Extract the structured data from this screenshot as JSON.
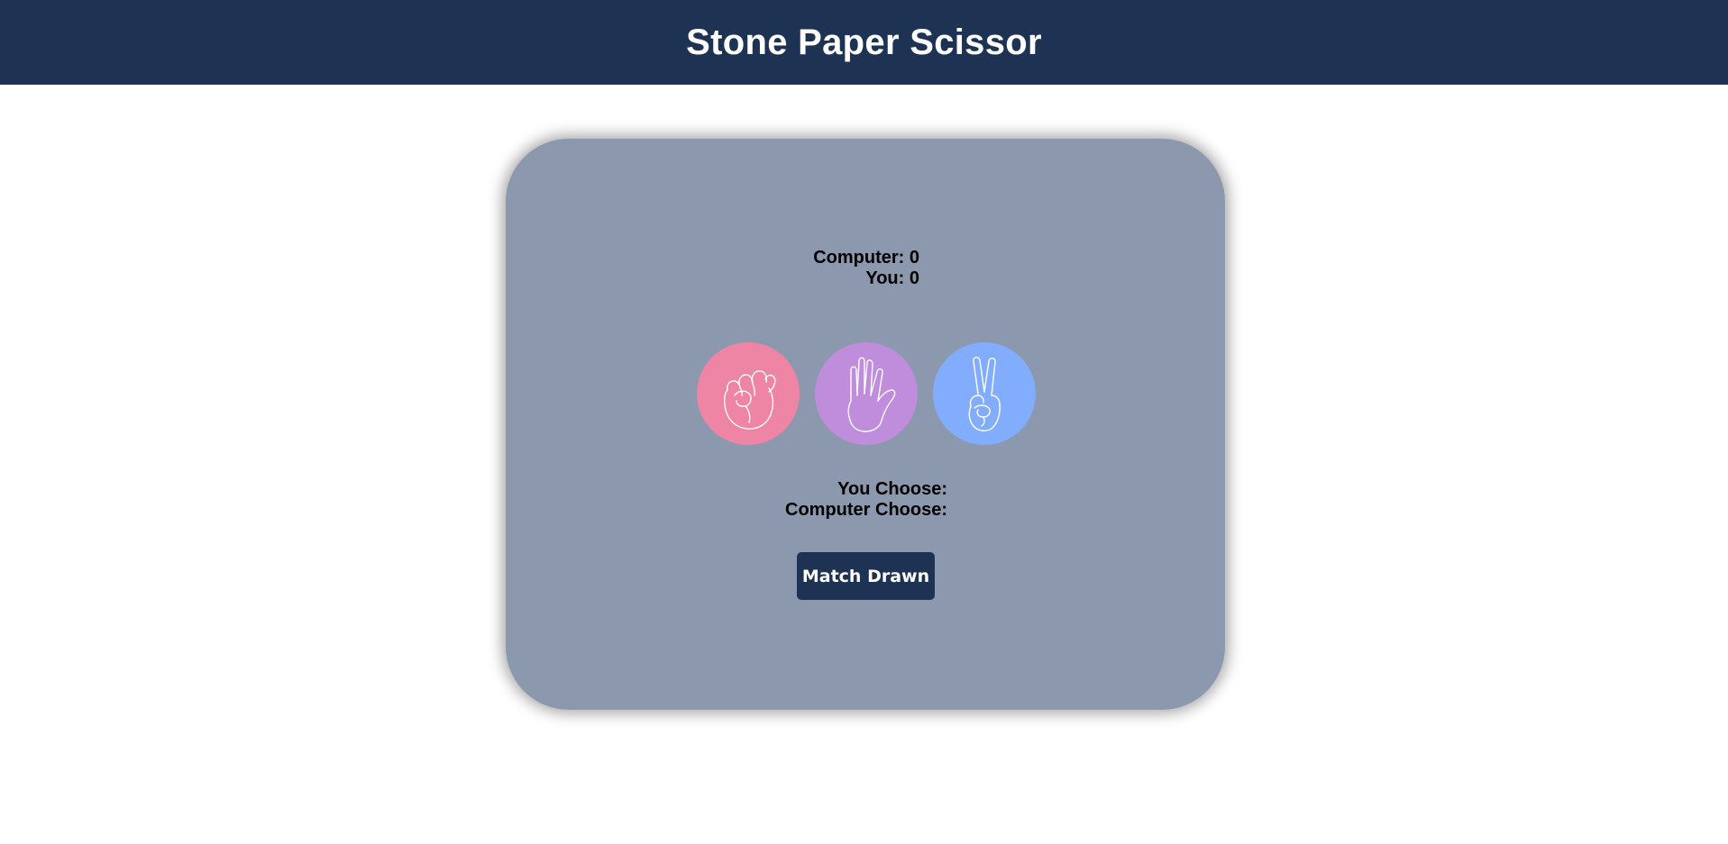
{
  "header": {
    "title": "Stone Paper Scissor"
  },
  "score": {
    "computer_label": "Computer: 0",
    "you_label": "You: 0"
  },
  "choices": [
    {
      "name": "stone",
      "icon": "fist-icon",
      "color": "#ef85a5"
    },
    {
      "name": "paper",
      "icon": "open-hand-icon",
      "color": "#c08ddd"
    },
    {
      "name": "scissor",
      "icon": "peace-hand-icon",
      "color": "#82adfc"
    }
  ],
  "picks": {
    "you_label": "You Choose:",
    "computer_label": "Computer Choose:"
  },
  "result": {
    "message": "Match Drawn"
  },
  "colors": {
    "header_bg": "#1e3354",
    "card_bg": "#8b98ae",
    "button_bg": "#1e3354"
  }
}
